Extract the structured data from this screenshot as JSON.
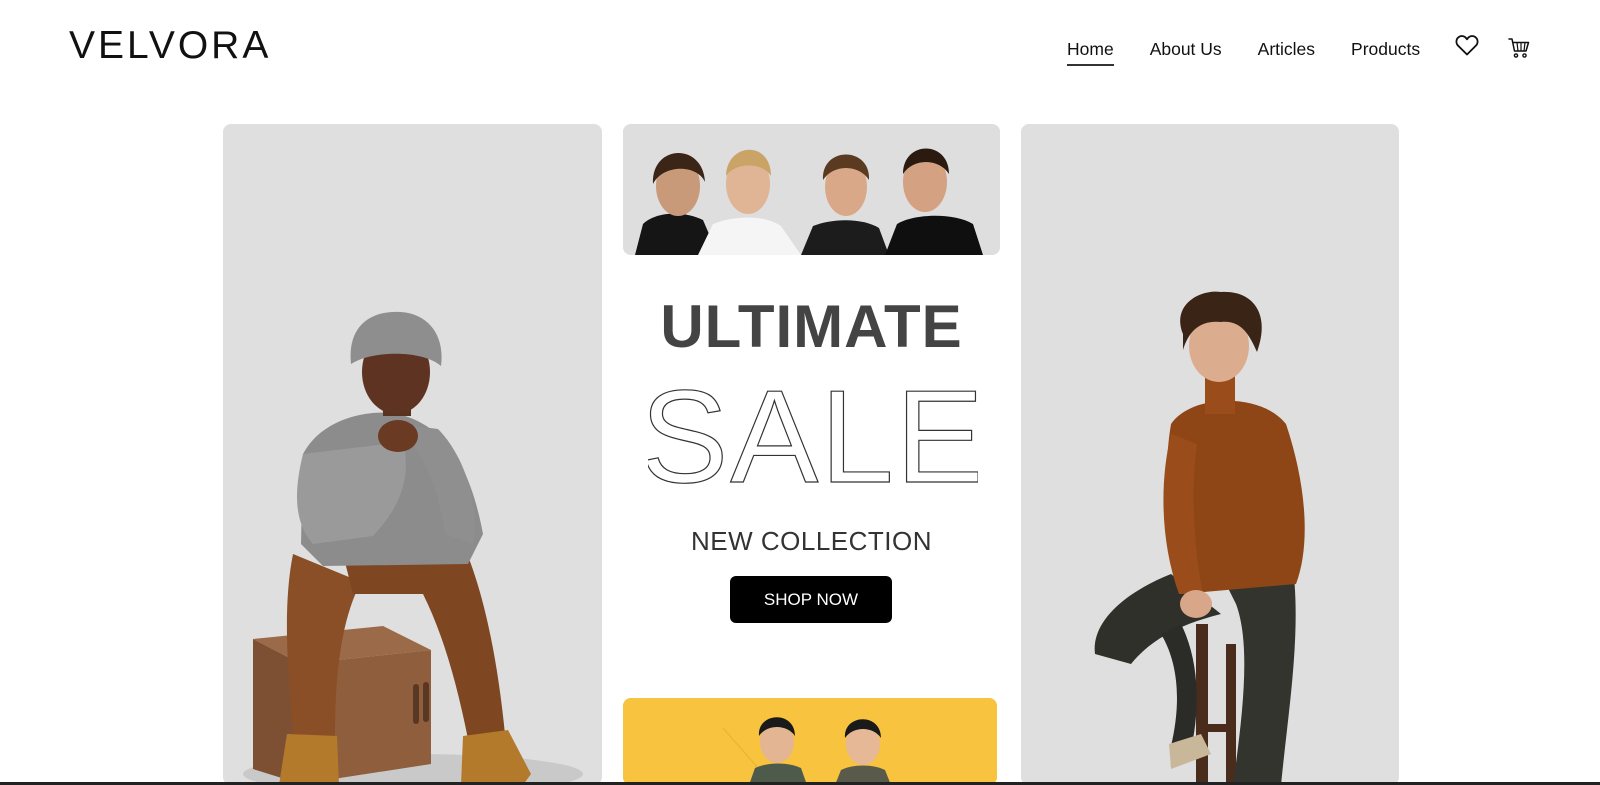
{
  "header": {
    "logo": "VELVORA",
    "nav": [
      {
        "label": "Home",
        "active": true
      },
      {
        "label": "About Us",
        "active": false
      },
      {
        "label": "Articles",
        "active": false
      },
      {
        "label": "Products",
        "active": false
      }
    ],
    "icons": [
      "heart-icon",
      "cart-icon"
    ]
  },
  "hero": {
    "headline_top": "ULTIMATE",
    "headline_outline": "SALE",
    "subheadline": "NEW COLLECTION",
    "cta_label": "SHOP NOW"
  },
  "images": {
    "left": "man-seated-on-wooden-box-photo",
    "group": "four-men-group-photo",
    "right": "man-leaning-on-stool-photo",
    "bottom": "two-men-yellow-background-photo"
  },
  "colors": {
    "card_bg": "#dfdfdf",
    "accent_yellow": "#f8c33e",
    "button_bg": "#000000",
    "heading_gray": "#444444"
  }
}
